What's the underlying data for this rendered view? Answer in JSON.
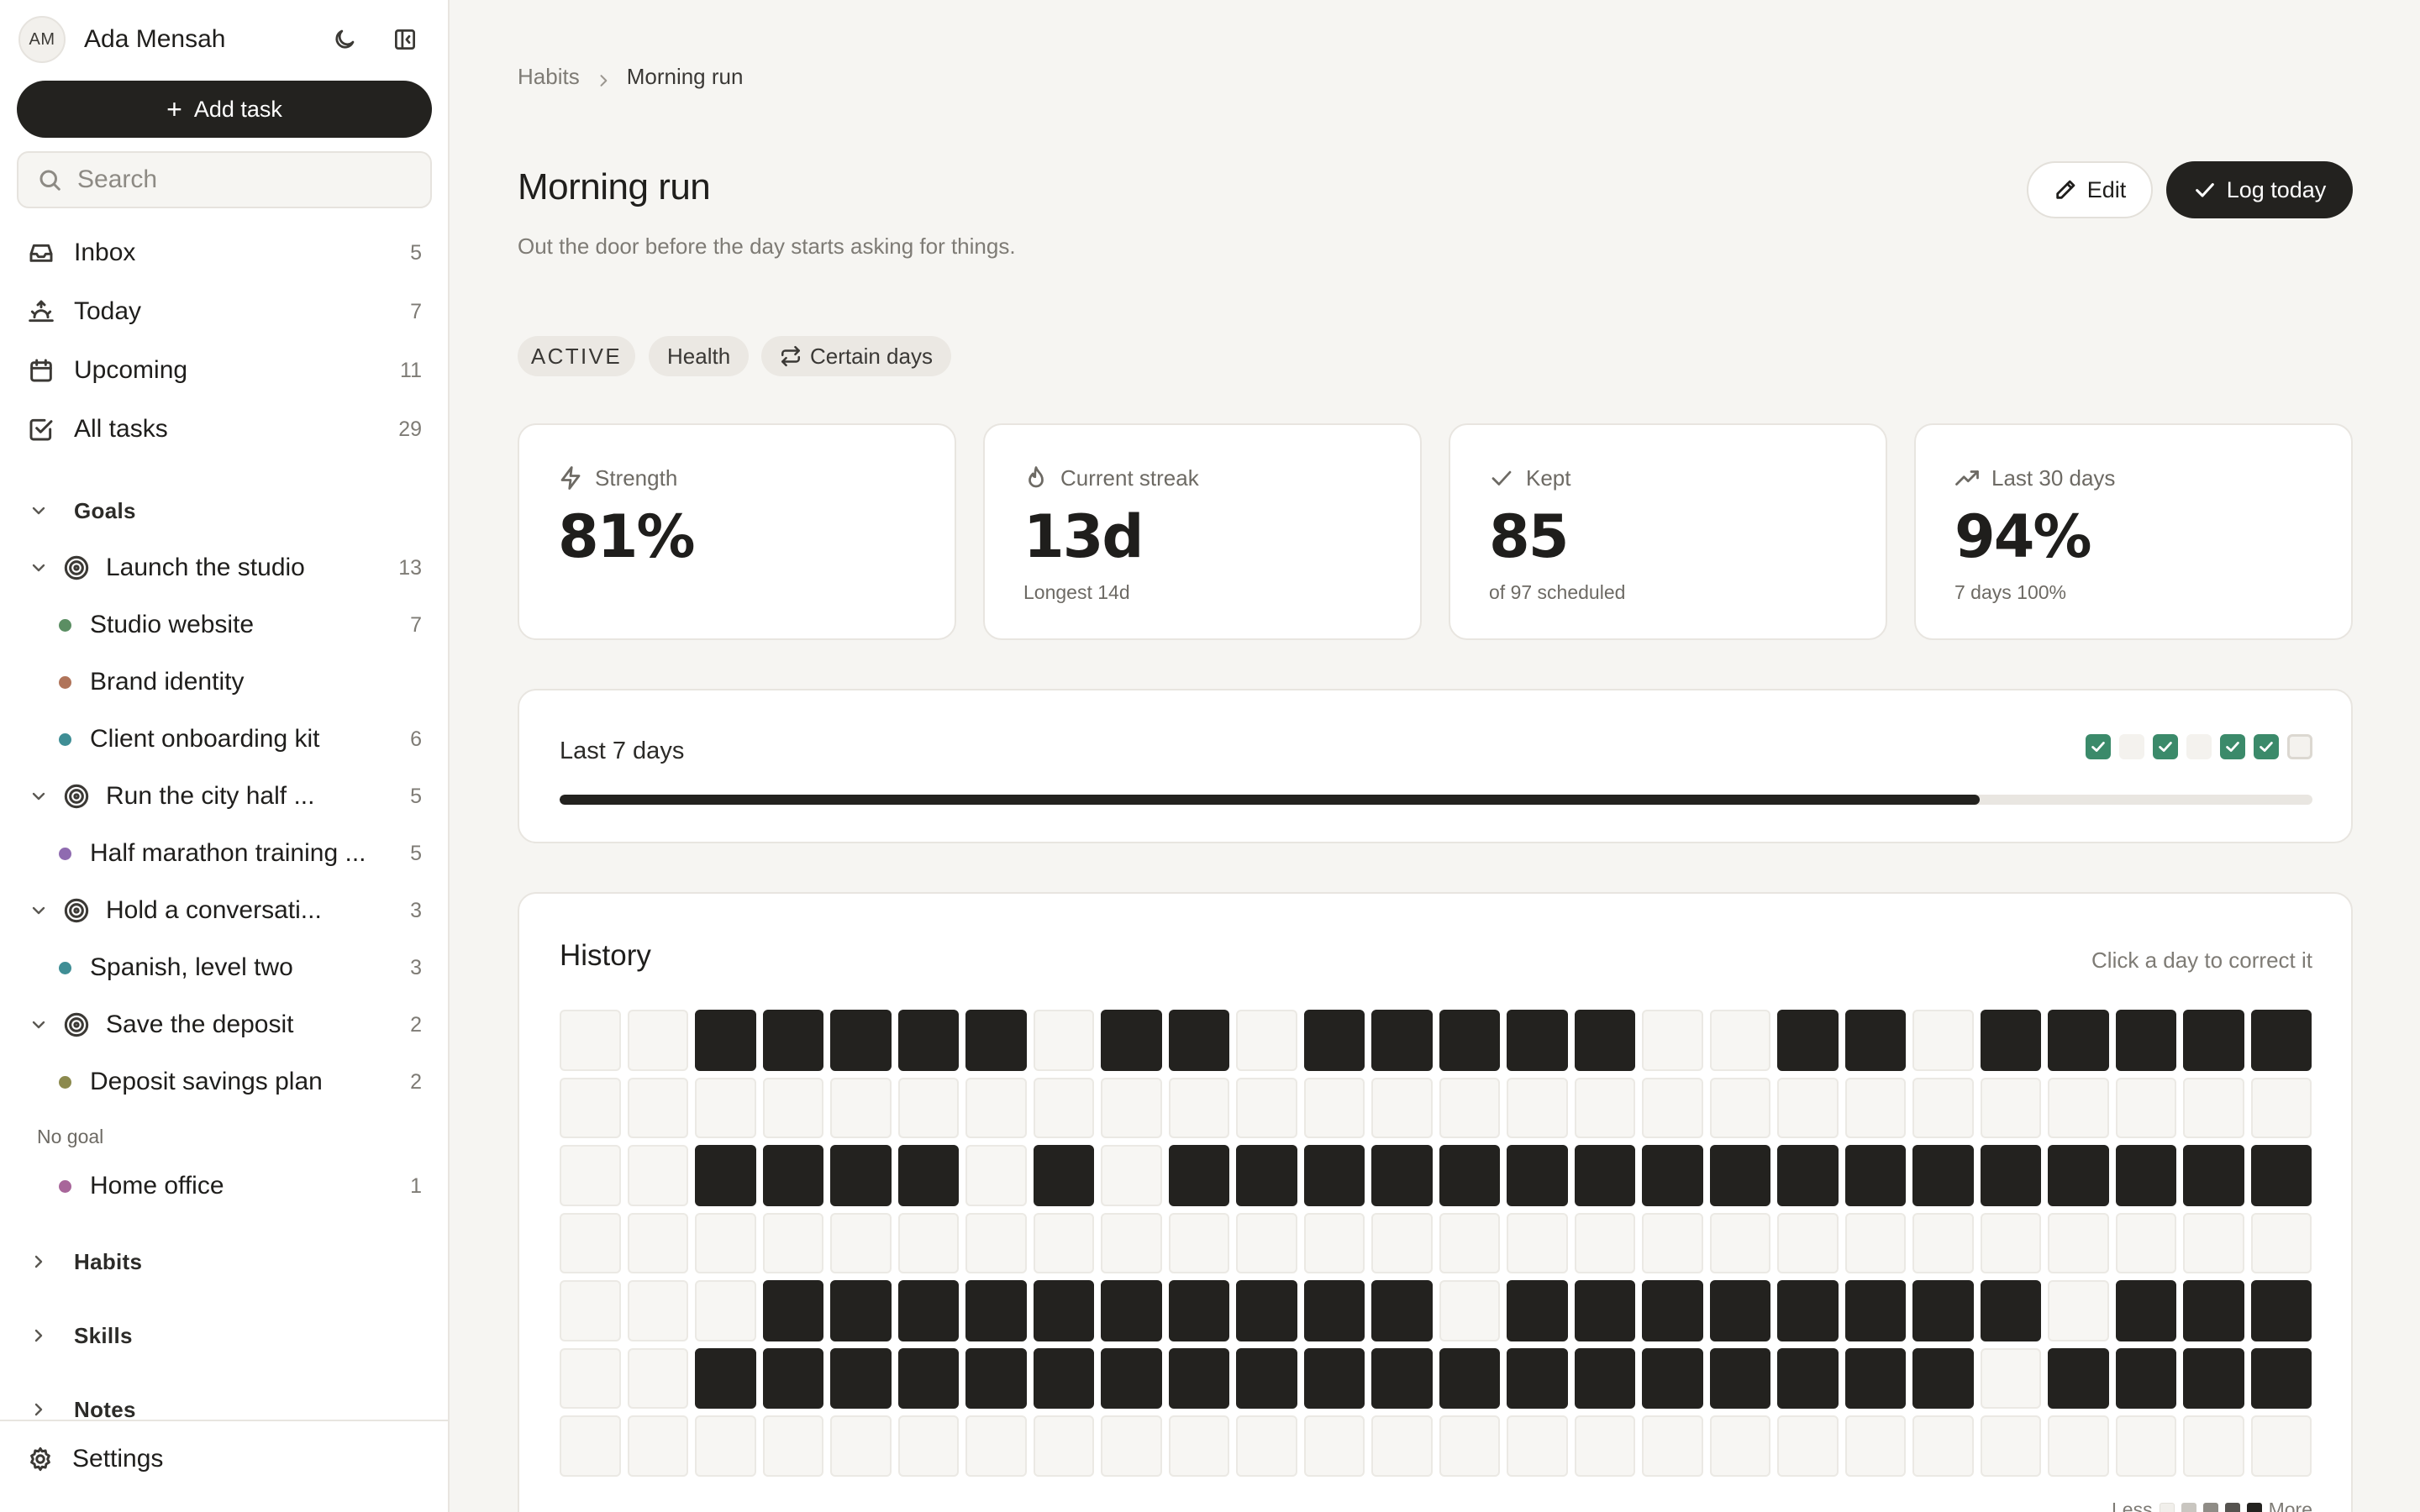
{
  "sidebar": {
    "user": {
      "initials": "AM",
      "name": "Ada Mensah"
    },
    "add_task_label": "Add task",
    "search_placeholder": "Search",
    "nav": [
      {
        "label": "Inbox",
        "count": "5",
        "icon": "inbox-icon"
      },
      {
        "label": "Today",
        "count": "7",
        "icon": "sunrise-icon"
      },
      {
        "label": "Upcoming",
        "count": "11",
        "icon": "calendar-icon"
      },
      {
        "label": "All tasks",
        "count": "29",
        "icon": "check-square-icon"
      }
    ],
    "goals_label": "Goals",
    "goals": [
      {
        "label": "Launch the studio",
        "count": "13"
      },
      {
        "label": "Run the city half ...",
        "count": "5"
      },
      {
        "label": "Hold a conversati...",
        "count": "3"
      },
      {
        "label": "Save the deposit",
        "count": "2"
      }
    ],
    "projects": [
      {
        "label": "Studio website",
        "count": "7",
        "color": "#5b8e63"
      },
      {
        "label": "Brand identity",
        "count": "",
        "color": "#b0745a"
      },
      {
        "label": "Client onboarding kit",
        "count": "6",
        "color": "#3f8e95"
      },
      {
        "label": "Half marathon training ...",
        "count": "5",
        "color": "#8f6bb0"
      },
      {
        "label": "Spanish, level two",
        "count": "3",
        "color": "#3f8e95"
      },
      {
        "label": "Deposit savings plan",
        "count": "2",
        "color": "#8c8a4e"
      },
      {
        "label": "Home office",
        "count": "1",
        "color": "#a8669a"
      }
    ],
    "no_goal_label": "No goal",
    "sections": {
      "habits": "Habits",
      "skills": "Skills",
      "notes": "Notes"
    },
    "settings_label": "Settings"
  },
  "main": {
    "breadcrumb": {
      "parent": "Habits",
      "current": "Morning run"
    },
    "title": "Morning run",
    "subtitle": "Out the door before the day starts asking for things.",
    "edit_label": "Edit",
    "log_label": "Log today",
    "chips": {
      "status": "ACTIVE",
      "category": "Health",
      "schedule": "Certain days"
    },
    "stats": [
      {
        "label": "Strength",
        "value": "81%",
        "sub": "",
        "icon": "zap-icon"
      },
      {
        "label": "Current streak",
        "value": "13d",
        "sub": "Longest 14d",
        "icon": "flame-icon"
      },
      {
        "label": "Kept",
        "value": "85",
        "sub": "of 97 scheduled",
        "icon": "check-icon"
      },
      {
        "label": "Last 30 days",
        "value": "94%",
        "sub": "7 days 100%",
        "icon": "trending-up-icon"
      }
    ],
    "week": {
      "title": "Last 7 days",
      "days": [
        "done",
        "miss",
        "done",
        "miss",
        "done",
        "done",
        "today"
      ],
      "progress": 0.81
    },
    "history": {
      "title": "History",
      "hint": "Click a day to correct it",
      "rows": [
        "00111110110111110011011111",
        "00000000000000000000000000",
        "00111101011111111111111111",
        "00000000000000000000000000",
        "00011111111110111111110111",
        "00111111111111111111101111",
        "00000000000000000000000000"
      ],
      "legend_less": "Less",
      "legend_more": "More"
    },
    "colors": {
      "accent_dark": "#23221f",
      "done_green": "#3b8a6a"
    }
  }
}
